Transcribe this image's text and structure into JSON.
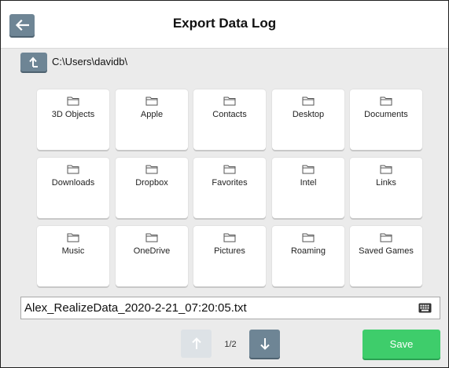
{
  "header": {
    "title": "Export Data Log"
  },
  "path": {
    "current": "C:\\Users\\davidb\\"
  },
  "folders": [
    {
      "label": "3D Objects"
    },
    {
      "label": "Apple"
    },
    {
      "label": "Contacts"
    },
    {
      "label": "Desktop"
    },
    {
      "label": "Documents"
    },
    {
      "label": "Downloads"
    },
    {
      "label": "Dropbox"
    },
    {
      "label": "Favorites"
    },
    {
      "label": "Intel"
    },
    {
      "label": "Links"
    },
    {
      "label": "Music"
    },
    {
      "label": "OneDrive"
    },
    {
      "label": "Pictures"
    },
    {
      "label": "Roaming"
    },
    {
      "label": "Saved Games"
    }
  ],
  "filename": {
    "value": "Alex_RealizeData_2020-2-21_07:20:05.txt"
  },
  "pager": {
    "page_text": "1/2"
  },
  "actions": {
    "save_label": "Save"
  },
  "icons": {
    "back": "arrow-left-icon",
    "up_directory": "arrow-up-turn-icon",
    "folder": "folder-icon",
    "keyboard": "keyboard-icon",
    "page_up": "arrow-up-icon",
    "page_down": "arrow-down-icon"
  },
  "colors": {
    "accent_button": "#6e8595",
    "save_button": "#3ecd6b",
    "disabled_button": "#dde2e6",
    "background": "#ebebeb"
  }
}
